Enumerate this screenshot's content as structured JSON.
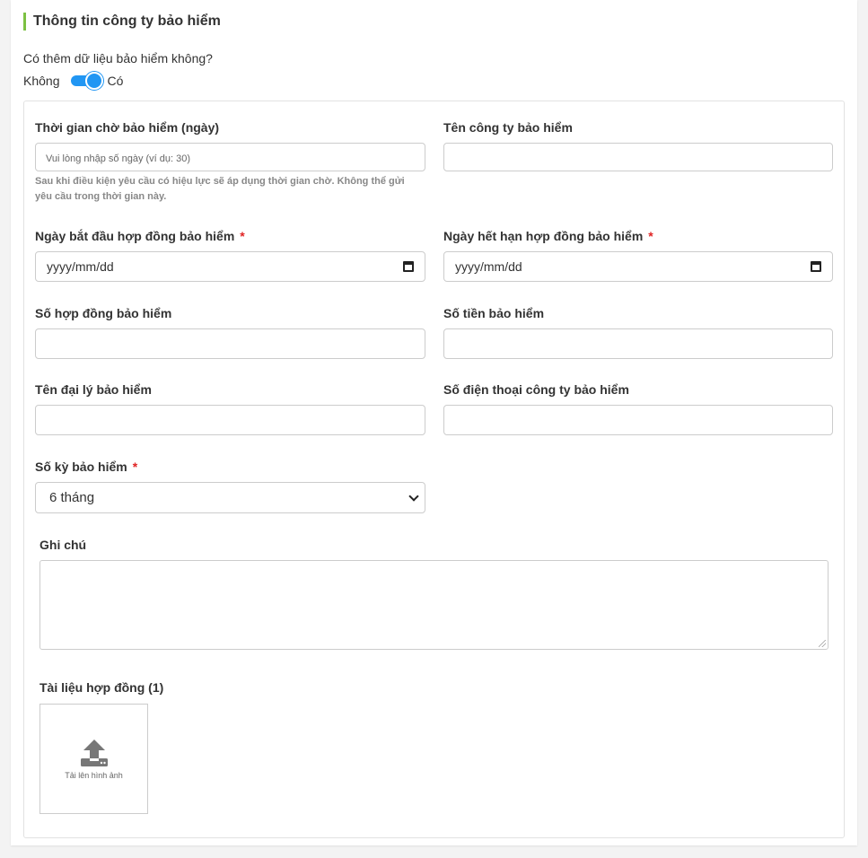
{
  "section": {
    "title": "Thông tin công ty bảo hiểm"
  },
  "insurance_toggle": {
    "question": "Có thêm dữ liệu bảo hiểm không?",
    "off_label": "Không",
    "on_label": "Có",
    "state": "on"
  },
  "fields": {
    "waiting_time": {
      "label": "Thời gian chờ bảo hiểm (ngày)",
      "placeholder": "Vui lòng nhập số ngày (ví dụ: 30)",
      "help_line1": "Sau khi điều kiện yêu cầu có hiệu lực sẽ áp dụng thời gian chờ. Không thể gửi",
      "help_line2": "yêu cầu trong thời gian này."
    },
    "company_name": {
      "label": "Tên công ty bảo hiểm",
      "value": ""
    },
    "start_date": {
      "label": "Ngày bắt đầu hợp đồng bảo hiểm",
      "required": "*",
      "placeholder": "yyyy/mm/dd"
    },
    "end_date": {
      "label": "Ngày hết hạn hợp đồng bảo hiểm",
      "required": "*",
      "placeholder": "yyyy/mm/dd"
    },
    "contract_number": {
      "label": "Số hợp đồng bảo hiểm",
      "value": ""
    },
    "amount": {
      "label": "Số tiền bảo hiểm",
      "value": ""
    },
    "agent_name": {
      "label": "Tên đại lý bảo hiểm",
      "value": ""
    },
    "company_phone": {
      "label": "Số điện thoại công ty bảo hiểm",
      "value": ""
    },
    "term": {
      "label": "Số kỳ bảo hiểm",
      "required": "*",
      "selected": "6 tháng"
    },
    "note": {
      "label": "Ghi chú",
      "value": ""
    },
    "documents": {
      "label": "Tài liệu hợp đồng (1)",
      "upload_label": "Tải lên hình ảnh"
    }
  },
  "colors": {
    "accent_bar": "#7cc142",
    "toggle": "#2196f3",
    "required": "#e02424"
  },
  "icons": {
    "upload": "upload-icon",
    "calendar": "calendar-icon",
    "select": "chevron-down-icon",
    "resize": "resize-handle-icon"
  }
}
